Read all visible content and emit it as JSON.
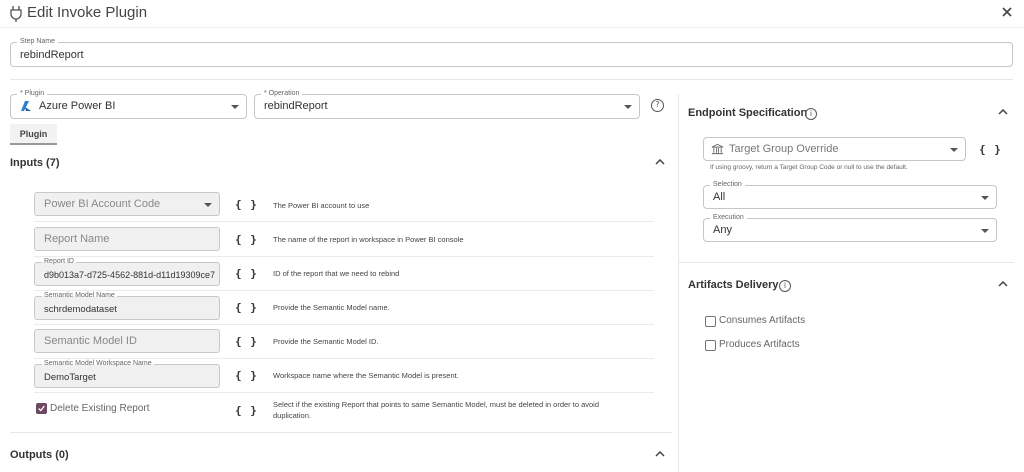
{
  "title": "Edit Invoke Plugin",
  "step_name": {
    "label": "Step Name",
    "value": "rebindReport"
  },
  "plugin": {
    "label": "* Plugin",
    "value": "Azure Power BI"
  },
  "operation": {
    "label": "* Operation",
    "value": "rebindReport"
  },
  "tab_label": "Plugin",
  "inputs": {
    "title": "Inputs (7)",
    "rows": [
      {
        "field_placeholder": "Power BI Account Code",
        "description": "The Power BI account to use"
      },
      {
        "field_placeholder": "Report Name",
        "description": "The name of the report in workspace in Power BI console"
      },
      {
        "field_label": "Report ID",
        "field_value": "d9b013a7-d725-4562-881d-d11d19309ce7",
        "description": "ID of the report that we need to rebind"
      },
      {
        "field_label": "Semantic Model Name",
        "field_value": "schrdemodataset",
        "description": "Provide the Semantic Model name."
      },
      {
        "field_placeholder": "Semantic Model ID",
        "description": "Provide the Semantic Model ID."
      },
      {
        "field_label": "Semantic Model Workspace Name",
        "field_value": "DemoTarget",
        "description": "Workspace name where the Semantic Model is present."
      },
      {
        "checkbox_label": "Delete Existing Report",
        "checked": true,
        "description_line1": "Select if the existing Report that points to same Semantic Model, must be deleted in order to avoid",
        "description_line2": "duplication."
      }
    ]
  },
  "braces_glyph": "{ }",
  "outputs": {
    "title": "Outputs (0)"
  },
  "endpoint": {
    "title": "Endpoint Specification",
    "target_group_placeholder": "Target Group Override",
    "help": "If using groovy, return a Target Group Code or null to use the default.",
    "selection": {
      "label": "Selection",
      "value": "All"
    },
    "execution": {
      "label": "Execution",
      "value": "Any"
    }
  },
  "artifacts": {
    "title": "Artifacts Delivery",
    "consumes": "Consumes Artifacts",
    "produces": "Produces Artifacts"
  },
  "icons": {
    "info": "i",
    "help": "?"
  },
  "colors": {
    "checkbox_checked": "#6b4a62",
    "azure_icon": "#2a7fd4"
  }
}
